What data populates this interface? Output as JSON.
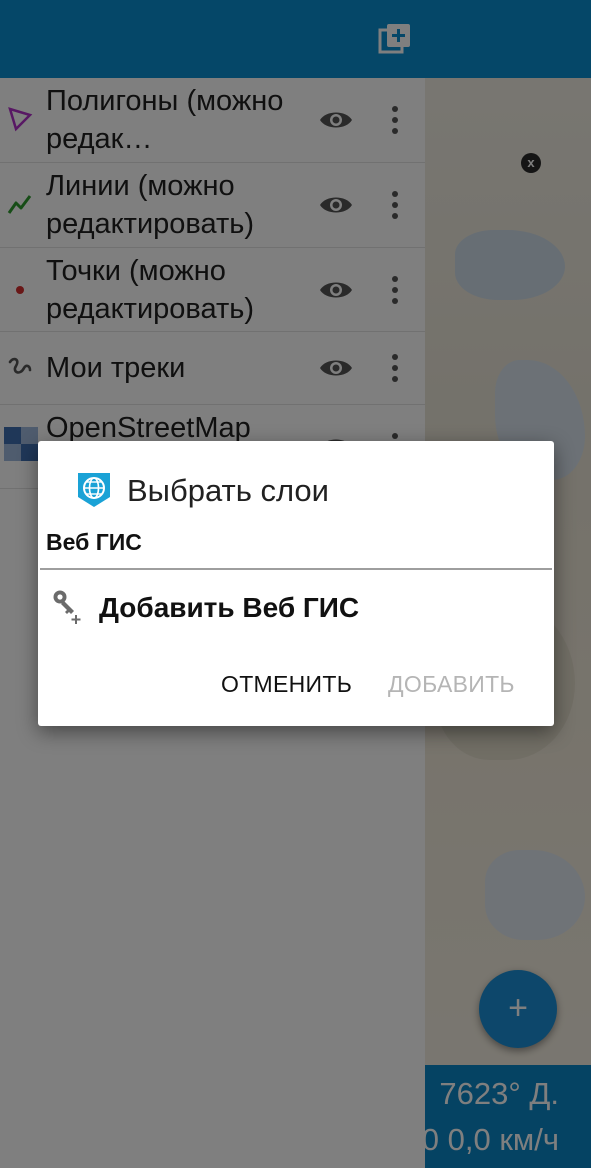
{
  "map": {
    "close_marker": "x",
    "fab_label": "+",
    "status_line_1": "7623° Д.",
    "status_line_2": "0 0,0 км/ч"
  },
  "drawer": {
    "layers": [
      {
        "label": "Полигоны (можно редак…",
        "icon": "polygon-icon",
        "color": "#b030c8"
      },
      {
        "label": "Линии (можно редактировать)",
        "icon": "line-icon",
        "color": "#2e9a2e"
      },
      {
        "label": "Точки (можно редактировать)",
        "icon": "point-icon",
        "color": "#d32f2f"
      },
      {
        "label": "Мои треки",
        "icon": "track-icon",
        "color": "#555555"
      },
      {
        "label": "OpenStreetMap",
        "icon": "osm-tile-icon",
        "color": "#3f6fb0"
      }
    ]
  },
  "dialog": {
    "title": "Выбрать слои",
    "subtitle": "Веб ГИС",
    "add_item_label": "Добавить Веб ГИС",
    "cancel_label": "ОТМЕНИТЬ",
    "add_label": "ДОБАВИТЬ"
  },
  "colors": {
    "toolbar": "#0a8fd1",
    "accent": "#1a8fd6",
    "disabled": "#b5b5b5"
  }
}
